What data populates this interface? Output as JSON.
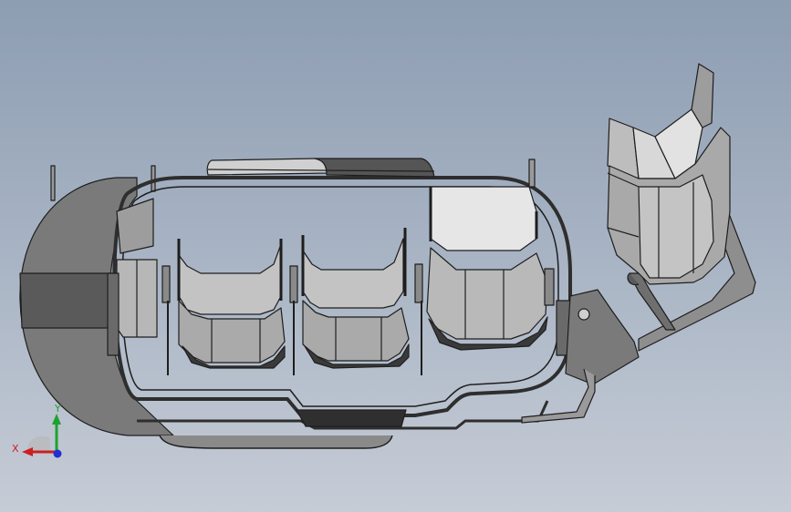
{
  "viewport": {
    "background_top": "#8d9db2",
    "background_bottom": "#c6ccd6"
  },
  "model": {
    "edge_color": "#1e1e1e",
    "face_light": "#c9c9c9",
    "face_mid": "#a9a9a9",
    "face_dark": "#6e6e6e",
    "face_shadow": "#3f3f3f"
  },
  "triad": {
    "x_label": "X",
    "y_label": "Y",
    "x_color": "#cc1f1f",
    "y_color": "#1fa12f",
    "z_color": "#1f2fd0"
  }
}
